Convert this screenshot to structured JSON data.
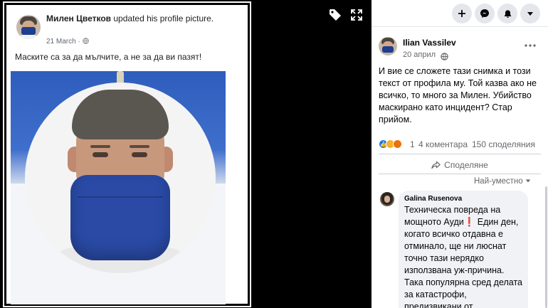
{
  "viewer": {
    "shared_post": {
      "author": "Милен Цветков",
      "action": "updated his profile picture.",
      "date": "21 March",
      "caption": "Маските са за да мълчите, а не за да ви пазят!"
    },
    "icons": [
      "tag-icon",
      "expand-icon"
    ]
  },
  "topbar": {
    "buttons": [
      {
        "name": "create-button",
        "icon": "plus-icon"
      },
      {
        "name": "messenger-button",
        "icon": "messenger-icon"
      },
      {
        "name": "notifications-button",
        "icon": "bell-icon"
      },
      {
        "name": "account-button",
        "icon": "caret-down-icon"
      }
    ]
  },
  "post": {
    "author": "Ilian Vassilev",
    "date": "20 април",
    "privacy_icon": "globe-icon",
    "text": "И вие се сложете тази снимка и този текст от профила му. Той казва ако не всичко, то много за Милен. Убийство маскирано като инцидент? Стар прийом.",
    "reactions": {
      "count": "1",
      "comments": "4 коментара",
      "shares": "150 споделяния",
      "types": [
        "like",
        "sad",
        "angry"
      ]
    },
    "share_label": "Споделяне",
    "sort_label": "Най-уместно"
  },
  "comment": {
    "author": "Galina Rusenova",
    "text_part1": "Техническа повреда на мощното Ауди",
    "text_part2": "Един ден, когато всичко отдавна е отминало, ще ни люснат точно тази нерядко използвана уж-причина. Така популярна сред делата за катастрофи, предизвикани от"
  },
  "colors": {
    "flag_blue": "#2f5dbd",
    "mask_blue": "#2a4aa6",
    "like": "#1877f2",
    "sad": "#f7b125",
    "angry": "#e9710f",
    "exclamation": "#e0245e"
  }
}
